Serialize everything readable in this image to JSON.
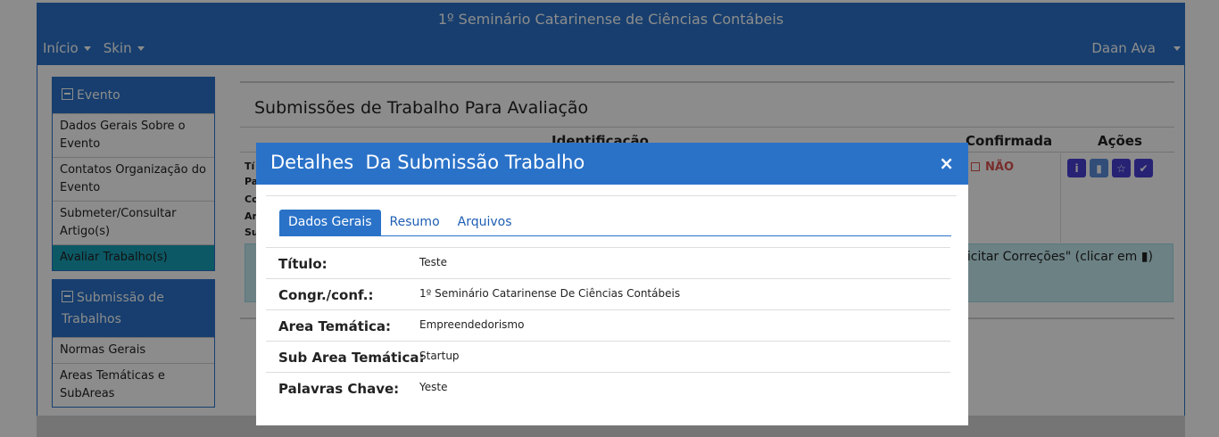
{
  "app": {
    "title": "1º Seminário Catarinense de Ciências Contábeis",
    "nav_left": [
      "Início",
      "Skin"
    ],
    "user": "Daan Ava"
  },
  "sidebar": {
    "event_header": "Evento",
    "event_items": [
      "Dados Gerais Sobre o Evento",
      "Contatos Organização do Evento",
      "Submeter/Consultar Artigo(s)",
      "Avaliar Trabalho(s)"
    ],
    "submission_header": "Submissão de Trabalhos",
    "submission_items": [
      "Normas Gerais",
      "Areas Temáticas e SubAreas"
    ]
  },
  "main": {
    "title": "Submissões de Trabalho Para Avaliação",
    "col_identificacao": "Identificação",
    "col_confirmada": "Confirmada",
    "col_acoes": "Ações",
    "confirmada_value": "NÃO",
    "stub_labels": [
      "Tí",
      "Pa",
      "Co",
      "Ar",
      "Su"
    ],
    "info_text": "licitar Correções\" (clicar em"
  },
  "modal": {
    "title": "Detalhes  Da Submissão Trabalho",
    "close": "×",
    "tabs": [
      "Dados Gerais",
      "Resumo",
      "Arquivos"
    ],
    "rows": [
      {
        "label": "Título:",
        "value": "Teste"
      },
      {
        "label": "Congr./conf.:",
        "value": "1º Seminário Catarinense De Ciências Contábeis"
      },
      {
        "label": "Area Temática:",
        "value": "Empreendedorismo"
      },
      {
        "label": "Sub Area Temática:",
        "value": "Startup"
      },
      {
        "label": "Palavras Chave:",
        "value": "Yeste"
      }
    ]
  },
  "colors": {
    "primary": "#2a72c8",
    "danger": "#d9534f",
    "action": "#4a3fd6",
    "info_bg": "#c5ecf1"
  }
}
